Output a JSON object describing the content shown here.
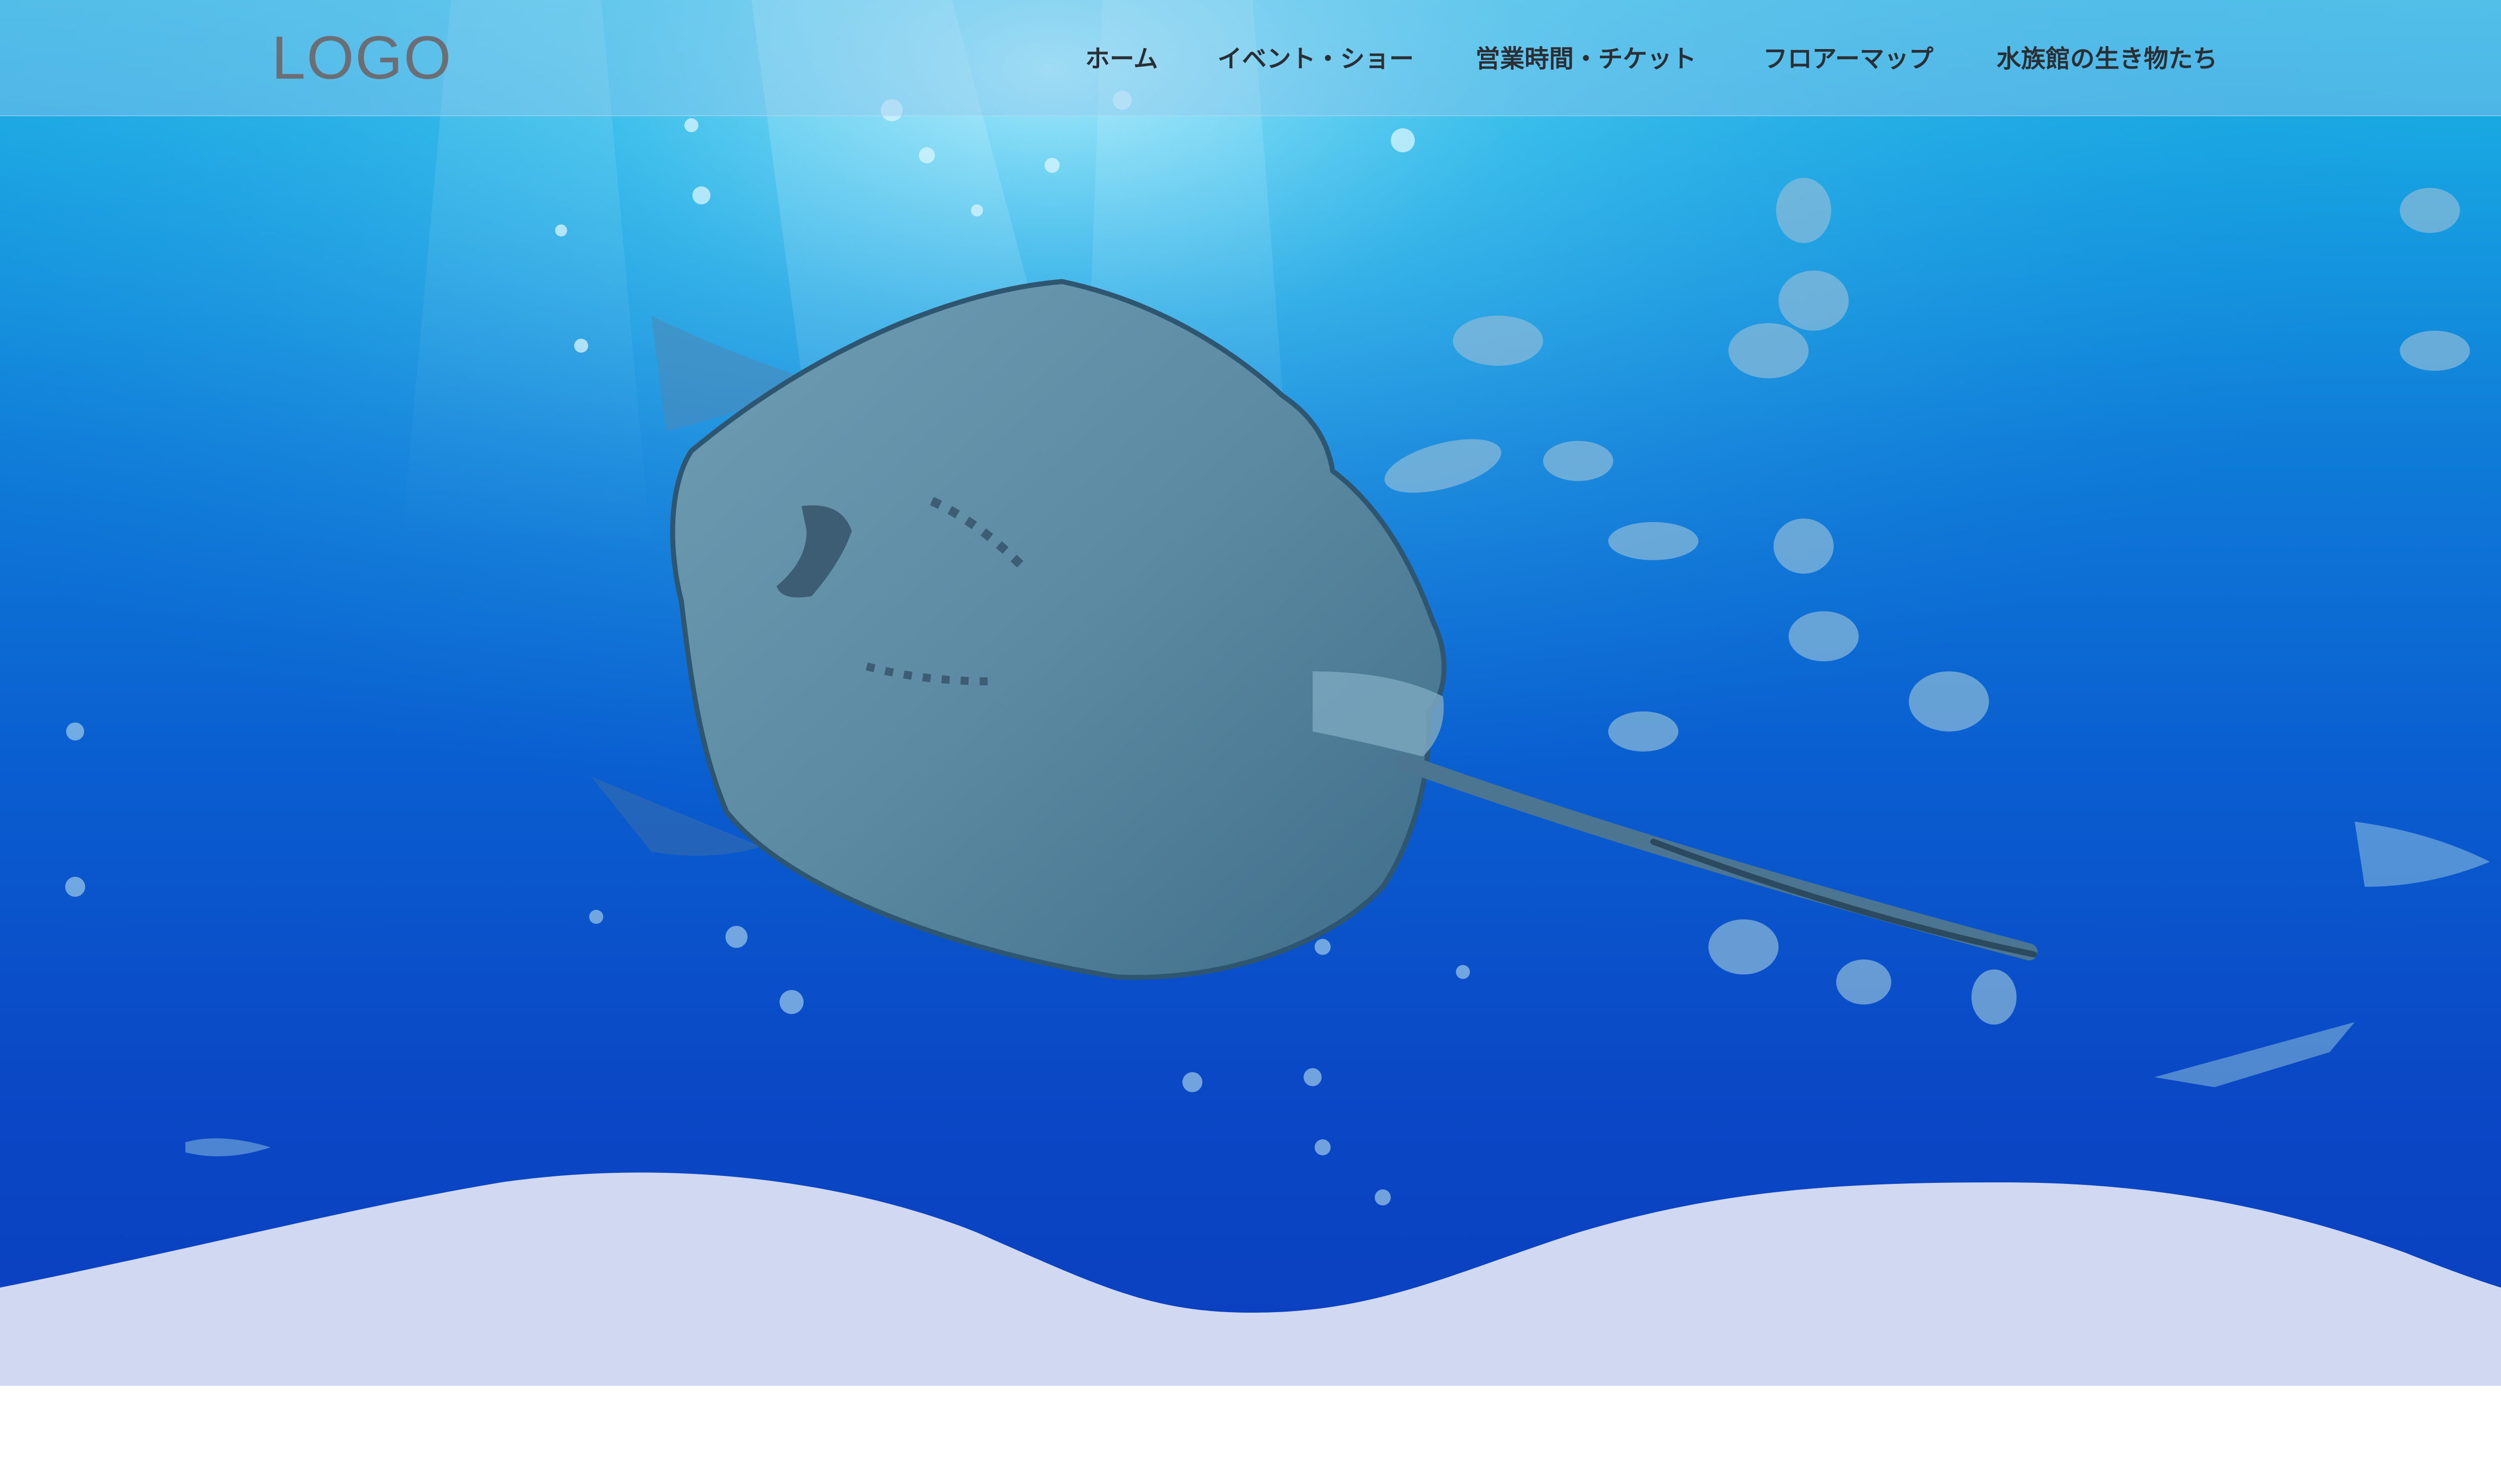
{
  "header": {
    "logo": "LOGO"
  },
  "nav": {
    "items": [
      {
        "label": "ホーム"
      },
      {
        "label": "イベント・ショー"
      },
      {
        "label": "営業時間・チケット"
      },
      {
        "label": "フロアーマップ"
      },
      {
        "label": "水族館の生き物たち"
      }
    ]
  },
  "hero": {
    "image": "stingray-underwater-photo",
    "colors": {
      "water_top": "#1fb9e6",
      "water_bottom": "#0b3fbf",
      "wave_fill": "#d0d8f2"
    }
  }
}
